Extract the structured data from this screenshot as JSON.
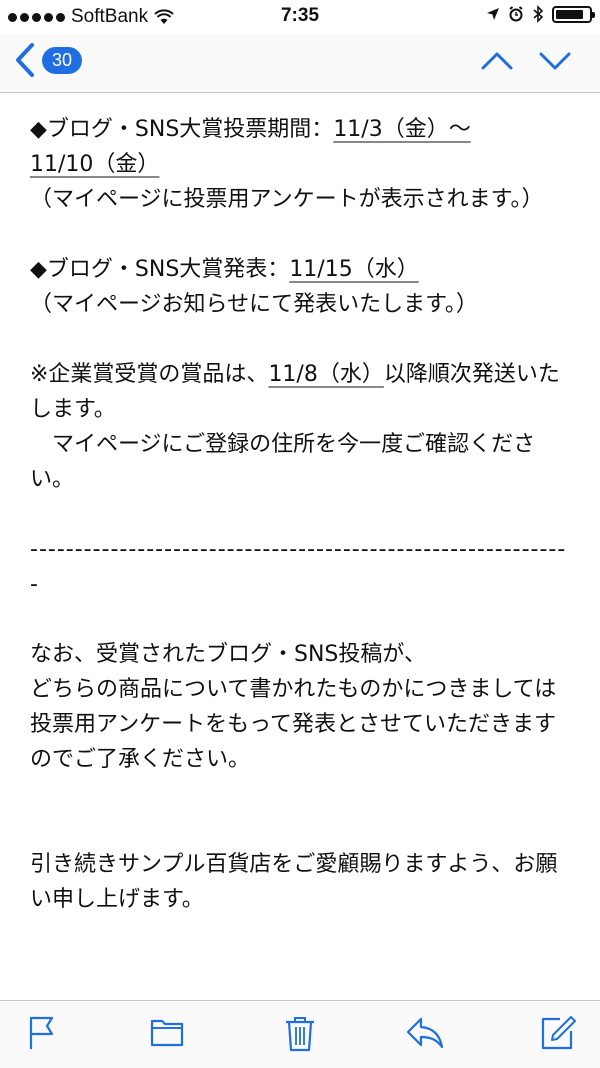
{
  "status": {
    "carrier": "SoftBank",
    "time": "7:35",
    "battery_level": 0.85
  },
  "nav": {
    "back_count": "30"
  },
  "email": {
    "line1": "◆ブログ・SNS大賞投票期間：",
    "line1_date": "11/3（金）〜",
    "line2_date": "11/10（金）",
    "line3": "（マイページに投票用アンケートが表示されます。）",
    "line4": "◆ブログ・SNS大賞発表：",
    "line4_date": "11/15（水）",
    "line5": "（マイページお知らせにて発表いたします。）",
    "line6_a": "※企業賞受賞の賞品は、",
    "line6_date": "11/8（水）",
    "line6_b": "以降順次発送いたします。",
    "line7": "　マイページにご登録の住所を今一度ご確認ください。",
    "divider": "-------------------------------------------------------------",
    "line8": "なお、受賞されたブログ・SNS投稿が、",
    "line9": "どちらの商品について書かれたものかにつきましては",
    "line10": "投票用アンケートをもって発表とさせていただきますのでご了承ください。",
    "line11": "引き続きサンプル百貨店をご愛顧賜りますよう、お願い申し上げます。"
  },
  "colors": {
    "accent": "#1f6fe0",
    "text": "#111111"
  }
}
